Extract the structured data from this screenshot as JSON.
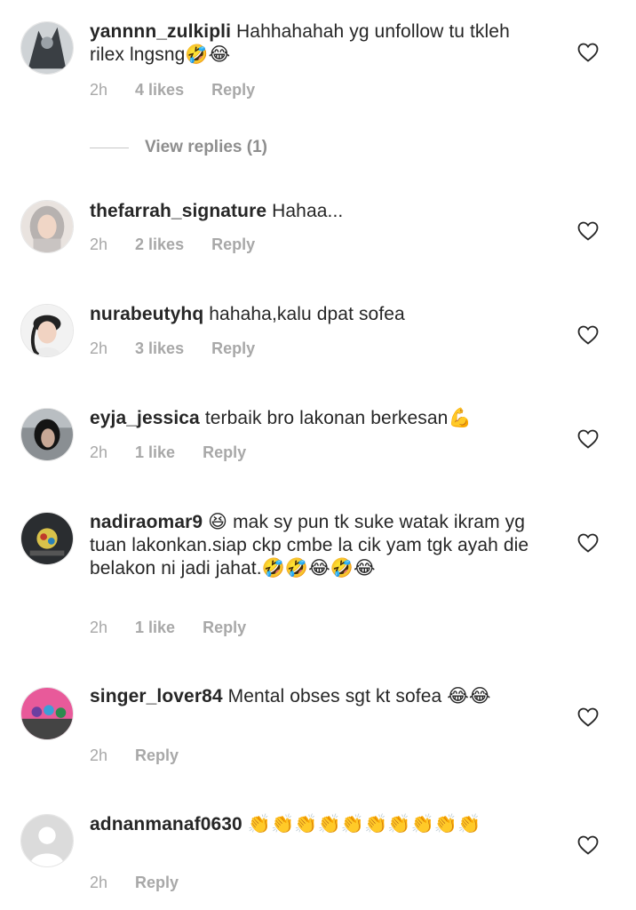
{
  "comments": [
    {
      "username": "yannnn_zulkipli",
      "text": "Hahhahahah yg unfollow tu tkleh rilex lngsng🤣😂",
      "time": "2h",
      "likes": "4 likes",
      "reply": "Reply",
      "view_replies": "View replies (1)"
    },
    {
      "username": "thefarrah_signature",
      "text": "Hahaa...",
      "time": "2h",
      "likes": "2 likes",
      "reply": "Reply"
    },
    {
      "username": "nurabeutyhq",
      "text": "hahaha,kalu dpat sofea",
      "time": "2h",
      "likes": "3 likes",
      "reply": "Reply"
    },
    {
      "username": "eyja_jessica",
      "text": "terbaik bro lakonan berkesan💪",
      "time": "2h",
      "likes": "1 like",
      "reply": "Reply"
    },
    {
      "username": "nadiraomar9",
      "text": "😆 mak sy pun tk suke watak ikram  yg tuan lakonkan.siap ckp cmbe la cik yam tgk ayah die belakon ni jadi jahat.🤣🤣😂🤣😂",
      "time": "2h",
      "likes": "1 like",
      "reply": "Reply"
    },
    {
      "username": "singer_lover84",
      "text": "Mental obses sgt kt sofea 😂😂",
      "time": "2h",
      "likes": "",
      "reply": "Reply"
    },
    {
      "username": "adnanmanaf0630",
      "text": "👏👏👏👏👏👏👏👏👏👏",
      "time": "2h",
      "likes": "",
      "reply": "Reply"
    }
  ],
  "icons": {
    "heart": "heart-outline-icon",
    "avatar_default": "default-avatar-icon"
  },
  "colors": {
    "text": "#262626",
    "meta": "#a8a8a8",
    "divider": "#c7c7c7"
  }
}
